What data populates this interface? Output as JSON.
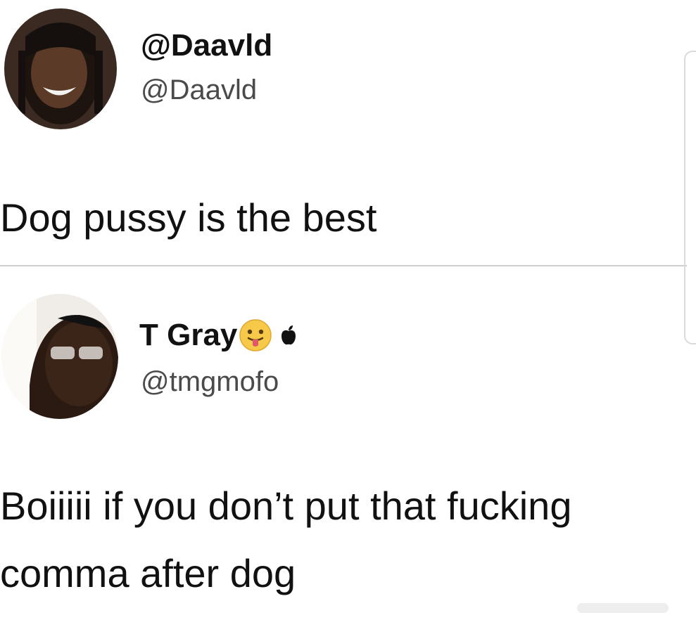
{
  "tweets": [
    {
      "display_name": "@Daavld",
      "handle": "@Daavld",
      "text": "Dog pussy is the best",
      "avatar_icon": "user-avatar-photo"
    },
    {
      "display_name": "T Gray",
      "name_emojis": [
        "face-with-tongue-emoji",
        "apple-logo-icon"
      ],
      "handle": "@tmgmofo",
      "text_lines": [
        "Boiiiii if you don’t put that fucking",
        "comma after dog"
      ],
      "avatar_icon": "user-avatar-photo"
    }
  ],
  "colors": {
    "background": "#ffffff",
    "text": "#111111",
    "handle": "#4a4a4a",
    "divider": "#cfcfcf"
  }
}
